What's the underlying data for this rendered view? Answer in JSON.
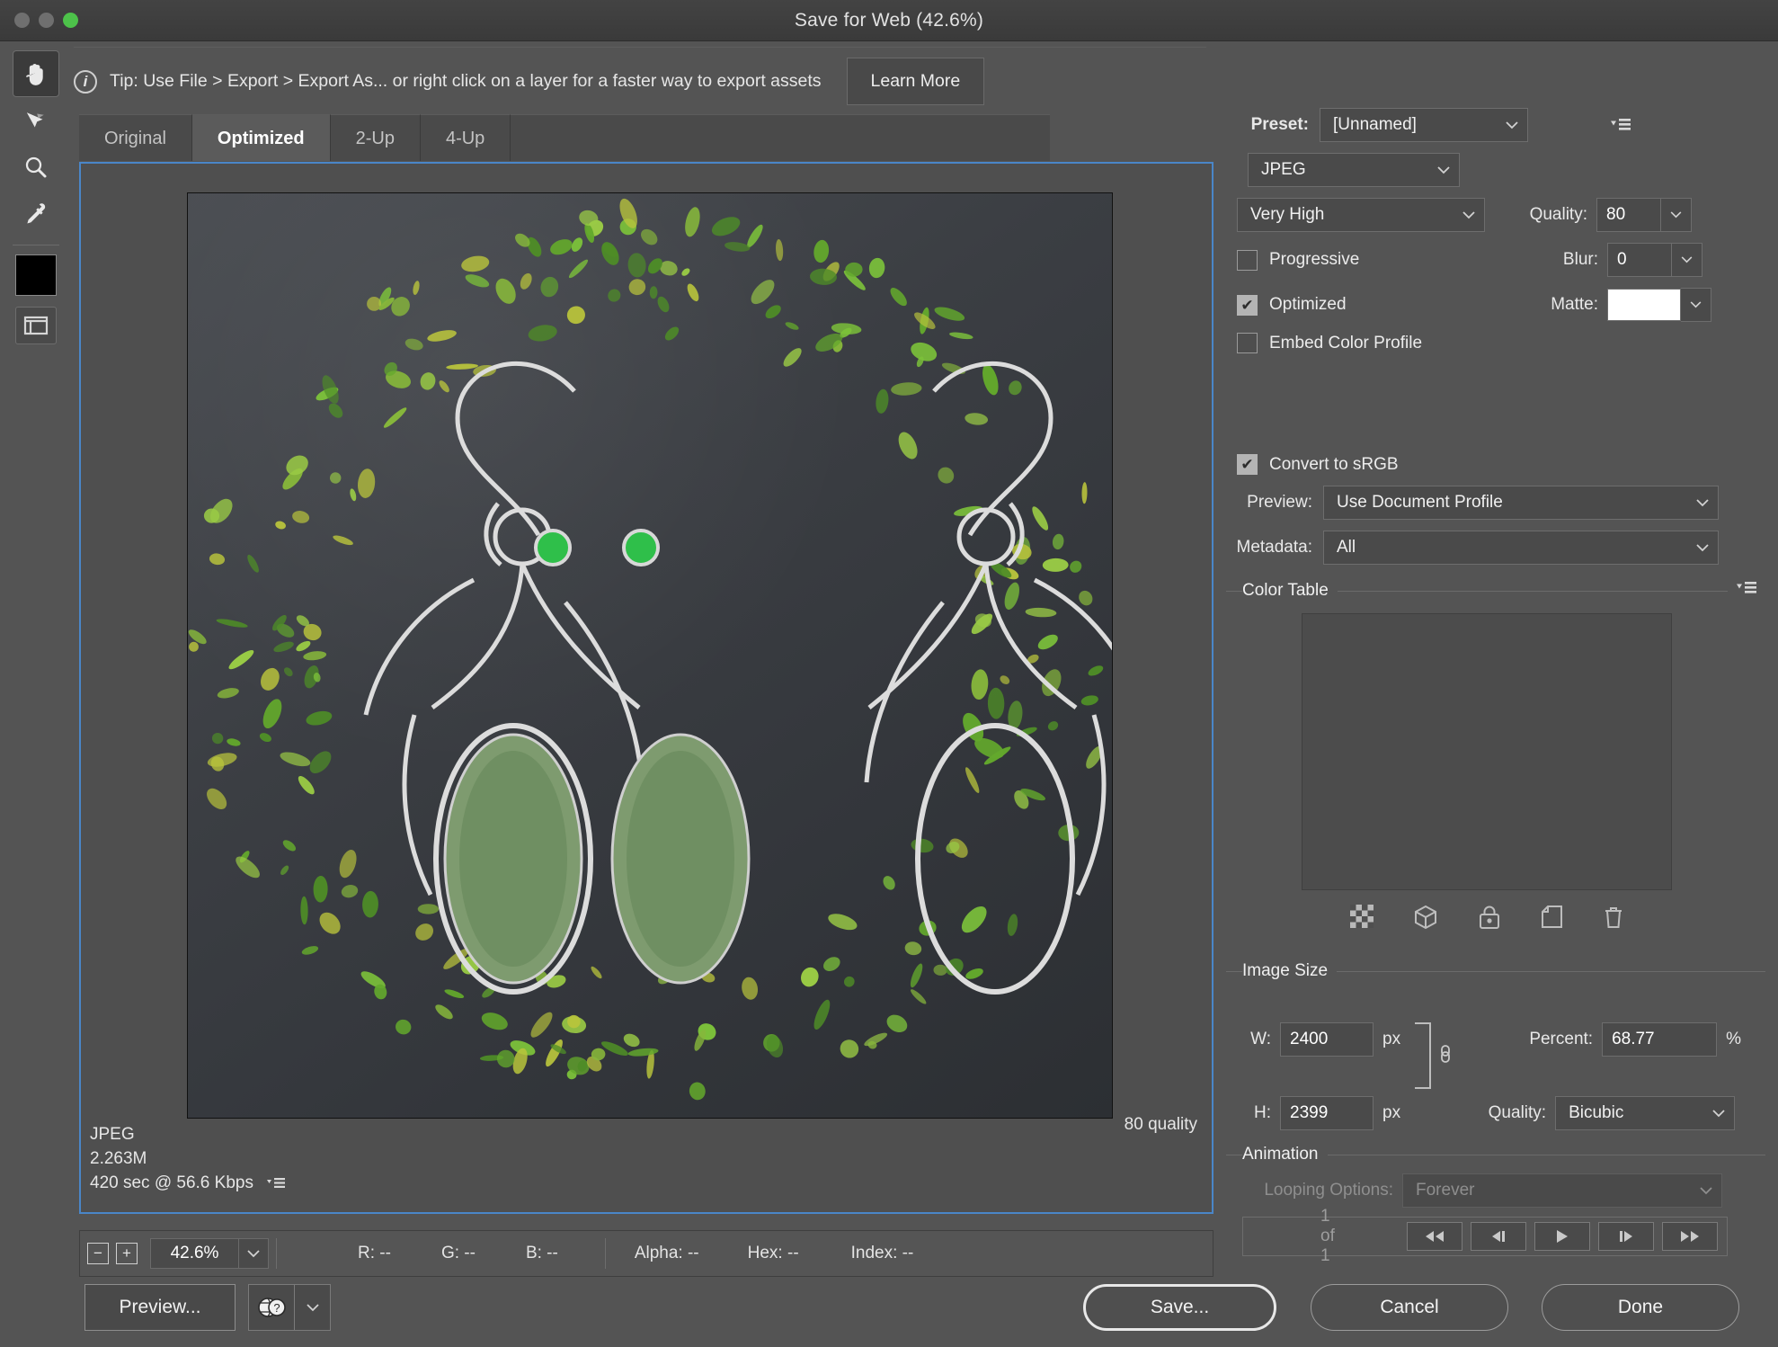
{
  "window": {
    "title": "Save for Web (42.6%)",
    "traffic_lights": [
      "close",
      "minimize",
      "maximize"
    ]
  },
  "tip": {
    "icon": "info-icon",
    "text": "Tip: Use File > Export > Export As...  or right click on a layer for a faster way to export assets",
    "learn_more_label": "Learn More"
  },
  "toolbar": {
    "tools": [
      {
        "name": "hand-tool",
        "active": true
      },
      {
        "name": "slice-select-tool",
        "active": false
      },
      {
        "name": "zoom-tool",
        "active": false
      },
      {
        "name": "eyedropper-tool",
        "active": false
      }
    ],
    "foreground_color": "#000000",
    "slice_visibility_label": "toggle-slice-visibility"
  },
  "tabs": [
    {
      "label": "Original",
      "active": false
    },
    {
      "label": "Optimized",
      "active": true
    },
    {
      "label": "2-Up",
      "active": false
    },
    {
      "label": "4-Up",
      "active": false
    }
  ],
  "preview": {
    "format": "JPEG",
    "file_size": "2.263M",
    "download_time": "420 sec @ 56.6 Kbps",
    "quality_note": "80 quality"
  },
  "status": {
    "zoom_out": "−",
    "zoom_in": "+",
    "zoom_level": "42.6%",
    "r": "R: --",
    "g": "G: --",
    "b": "B: --",
    "alpha": "Alpha: --",
    "hex": "Hex: --",
    "index": "Index: --"
  },
  "settings": {
    "preset_label": "Preset:",
    "preset_value": "[Unnamed]",
    "format_value": "JPEG",
    "quality_preset_value": "Very High",
    "quality_label": "Quality:",
    "quality_value": "80",
    "progressive_label": "Progressive",
    "progressive_checked": false,
    "blur_label": "Blur:",
    "blur_value": "0",
    "optimized_label": "Optimized",
    "optimized_checked": true,
    "matte_label": "Matte:",
    "matte_color": "#ffffff",
    "embed_profile_label": "Embed Color Profile",
    "embed_profile_checked": false,
    "convert_srgb_label": "Convert to sRGB",
    "convert_srgb_checked": true,
    "preview_label": "Preview:",
    "preview_value": "Use Document Profile",
    "metadata_label": "Metadata:",
    "metadata_value": "All"
  },
  "color_table": {
    "title": "Color Table",
    "tools": [
      "transparency-icon",
      "web-safe-icon",
      "lock-icon",
      "new-color-icon",
      "delete-icon"
    ]
  },
  "image_size": {
    "title": "Image Size",
    "w_label": "W:",
    "w_value": "2400",
    "w_unit": "px",
    "h_label": "H:",
    "h_value": "2399",
    "h_unit": "px",
    "percent_label": "Percent:",
    "percent_value": "68.77",
    "percent_unit": "%",
    "quality_label": "Quality:",
    "quality_value": "Bicubic"
  },
  "animation": {
    "title": "Animation",
    "looping_label": "Looping Options:",
    "looping_value": "Forever",
    "frame_counter": "1 of 1",
    "controls": [
      "first-frame",
      "previous-frame",
      "play",
      "next-frame",
      "last-frame"
    ]
  },
  "footer": {
    "preview_label": "Preview...",
    "browser_icon": "browser-icon",
    "save_label": "Save...",
    "cancel_label": "Cancel",
    "done_label": "Done"
  },
  "colors": {
    "accent": "#4a86c8",
    "panel_bg": "#545454",
    "titlebar_bg": "#3f3f3f",
    "maximize_green": "#4dc24a"
  }
}
